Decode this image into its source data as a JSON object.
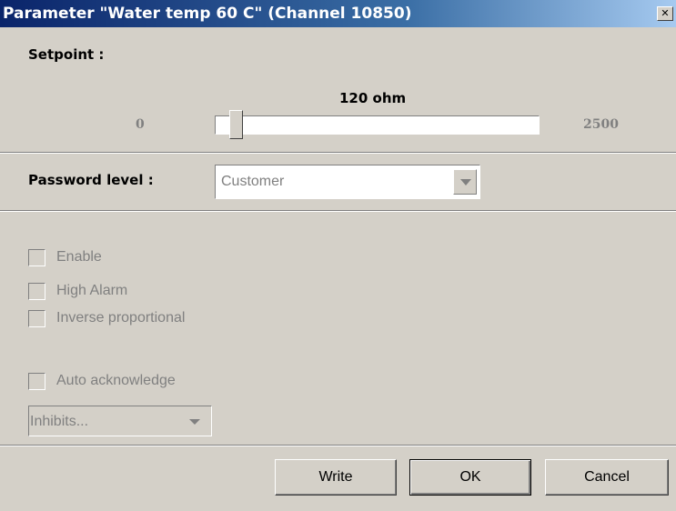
{
  "window": {
    "title": "Parameter \"Water temp 60 C\" (Channel 10850)",
    "close_symbol": "✕"
  },
  "setpoint": {
    "label": "Setpoint :",
    "value": "120 ohm",
    "min": "0",
    "max": "2500",
    "slider_fraction": 0.048
  },
  "password": {
    "label": "Password level :",
    "selected": "Customer"
  },
  "options": {
    "enable": "Enable",
    "high_alarm": "High Alarm",
    "inverse": "Inverse proportional",
    "auto_ack": "Auto acknowledge",
    "inhibits": "Inhibits..."
  },
  "buttons": {
    "write": "Write",
    "ok": "OK",
    "cancel": "Cancel"
  },
  "colors": {
    "titlebar": "#0a246a",
    "face": "#d4d0c8",
    "disabled_text": "#808080"
  }
}
